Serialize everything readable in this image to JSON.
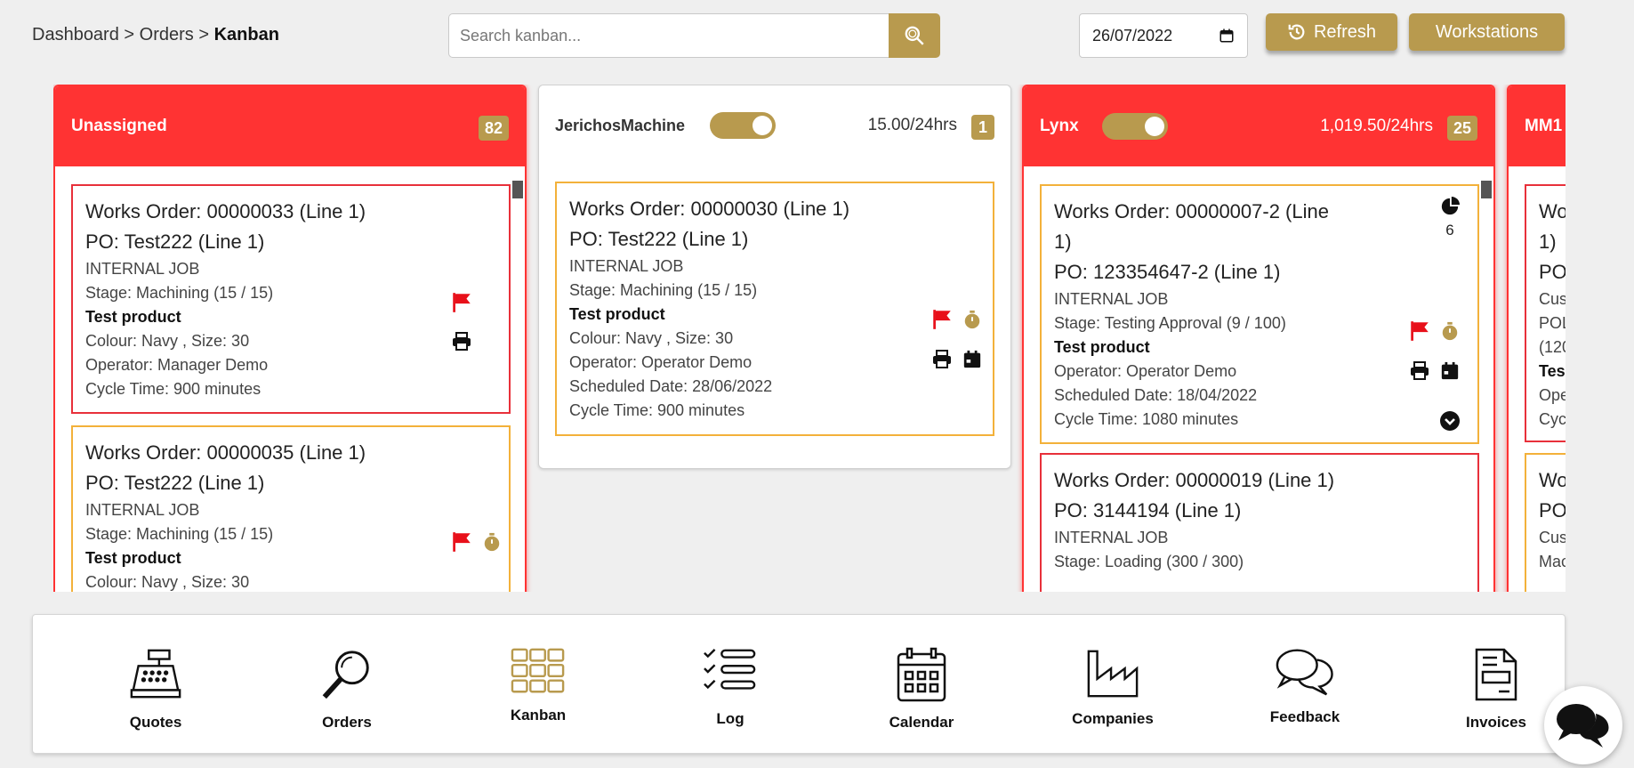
{
  "breadcrumb": {
    "dashboard": "Dashboard",
    "sep1": ">",
    "orders": "Orders",
    "sep2": ">",
    "current": "Kanban"
  },
  "search": {
    "placeholder": "Search kanban..."
  },
  "date": {
    "value": "26/07/2022"
  },
  "buttons": {
    "refresh": "Refresh",
    "workstations": "Workstations"
  },
  "columns": [
    {
      "name": "Unassigned",
      "count": "82",
      "status": "red",
      "cards": [
        {
          "title": "Works Order: 00000033 (Line 1)",
          "po": "PO: Test222 (Line 1)",
          "job": "INTERNAL JOB",
          "stage": "Stage: Machining (15 / 15)",
          "product": "Test product",
          "colour": "Colour: Navy , Size: 30",
          "operator": "Operator: Manager Demo",
          "cycle": "Cycle Time: 900 minutes",
          "border": "red"
        },
        {
          "title": "Works Order: 00000035 (Line 1)",
          "po": "PO: Test222 (Line 1)",
          "job": "INTERNAL JOB",
          "stage": "Stage: Machining (15 / 15)",
          "product": "Test product",
          "colour": "Colour: Navy , Size: 30",
          "border": "gold"
        }
      ]
    },
    {
      "name": "JerichosMachine",
      "hours": "15.00/24hrs",
      "count": "1",
      "status": "white",
      "cards": [
        {
          "title": "Works Order: 00000030 (Line 1)",
          "po": "PO: Test222 (Line 1)",
          "job": "INTERNAL JOB",
          "stage": "Stage: Machining (15 / 15)",
          "product": "Test product",
          "colour": "Colour: Navy , Size: 30",
          "operator": "Operator: Operator Demo",
          "scheduled": "Scheduled Date: 28/06/2022",
          "cycle": "Cycle Time: 900 minutes",
          "border": "gold"
        }
      ]
    },
    {
      "name": "Lynx",
      "hours": "1,019.50/24hrs",
      "count": "25",
      "status": "red",
      "cards": [
        {
          "title_a": "Works Order: 00000007-2 (Line",
          "title_b": "1)",
          "po": "PO: 123354647-2 (Line 1)",
          "job": "INTERNAL JOB",
          "stage": "Stage: Testing Approval (9 / 100)",
          "product": "Test product",
          "operator": "Operator: Operator Demo",
          "scheduled": "Scheduled Date: 18/04/2022",
          "cycle": "Cycle Time: 1080 minutes",
          "pie_count": "6",
          "border": "gold"
        },
        {
          "title": "Works Order: 00000019 (Line 1)",
          "po": "PO: 3144194 (Line 1)",
          "job": "INTERNAL JOB",
          "stage": "Stage: Loading (300 / 300)",
          "border": "red"
        }
      ]
    },
    {
      "name": "MM1",
      "cards": [
        {
          "l1": "Wo",
          "l2": "1)",
          "l3": "PO:",
          "l4": "Cus",
          "l5": "POL",
          "l6": "(120",
          "l7": "Tes",
          "l8": "Ope",
          "l9": "Cycl"
        },
        {
          "l1": "Wo",
          "l2": "PO:",
          "l3": "Cus",
          "l4": "Mac"
        }
      ]
    }
  ],
  "dock": [
    {
      "label": "Quotes",
      "icon": "cash-register-icon"
    },
    {
      "label": "Orders",
      "icon": "magnifier-icon"
    },
    {
      "label": "Kanban",
      "icon": "grid-icon"
    },
    {
      "label": "Log",
      "icon": "checklist-icon"
    },
    {
      "label": "Calendar",
      "icon": "calendar-icon"
    },
    {
      "label": "Companies",
      "icon": "factory-icon"
    },
    {
      "label": "Feedback",
      "icon": "chat-bubbles-icon"
    },
    {
      "label": "Invoices",
      "icon": "invoice-icon"
    }
  ],
  "colors": {
    "gold": "#b89a4e",
    "red": "#ff3333",
    "flag": "#e8101a",
    "card_gold_border": "#f3b13a"
  }
}
